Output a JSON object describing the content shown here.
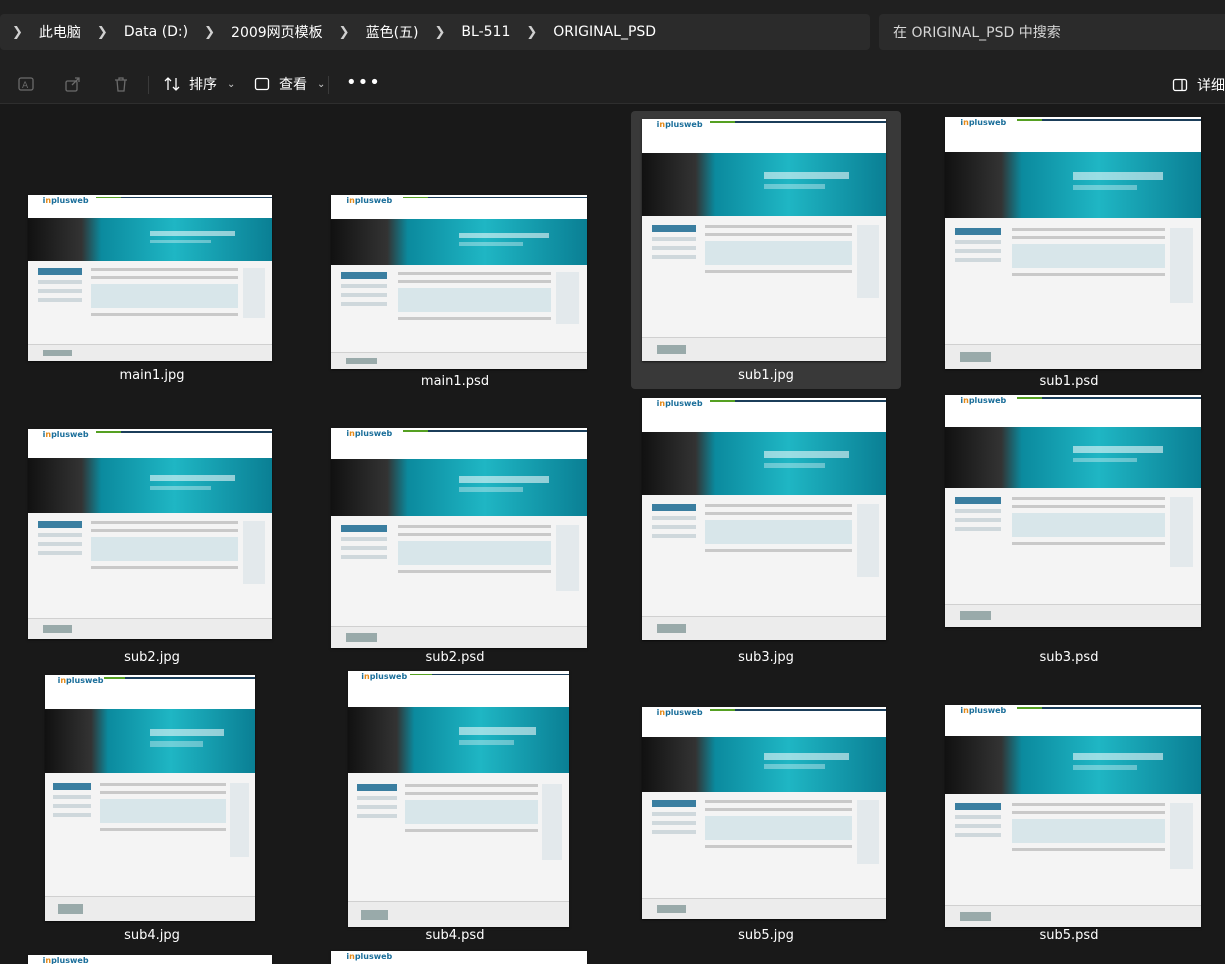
{
  "address": {
    "breadcrumb": [
      "此电脑",
      "Data (D:)",
      "2009网页模板",
      "蓝色(五)",
      "BL-511",
      "ORIGINAL_PSD"
    ],
    "search_placeholder": "在 ORIGINAL_PSD 中搜索"
  },
  "toolbar": {
    "sort_label": "排序",
    "view_label": "查看",
    "more_label": "•••",
    "details_label": "详细信"
  },
  "files": [
    {
      "name": "main1.jpg",
      "selected": false
    },
    {
      "name": "main1.psd",
      "selected": false
    },
    {
      "name": "sub1.jpg",
      "selected": true
    },
    {
      "name": "sub1.psd",
      "selected": false
    },
    {
      "name": "sub2.jpg",
      "selected": false
    },
    {
      "name": "sub2.psd",
      "selected": false
    },
    {
      "name": "sub3.jpg",
      "selected": false
    },
    {
      "name": "sub3.psd",
      "selected": false
    },
    {
      "name": "sub4.jpg",
      "selected": false
    },
    {
      "name": "sub4.psd",
      "selected": false
    },
    {
      "name": "sub5.jpg",
      "selected": false
    },
    {
      "name": "sub5.psd",
      "selected": false
    }
  ],
  "colors": {
    "background": "#191919",
    "bar": "#202020",
    "selection": "#393939"
  }
}
